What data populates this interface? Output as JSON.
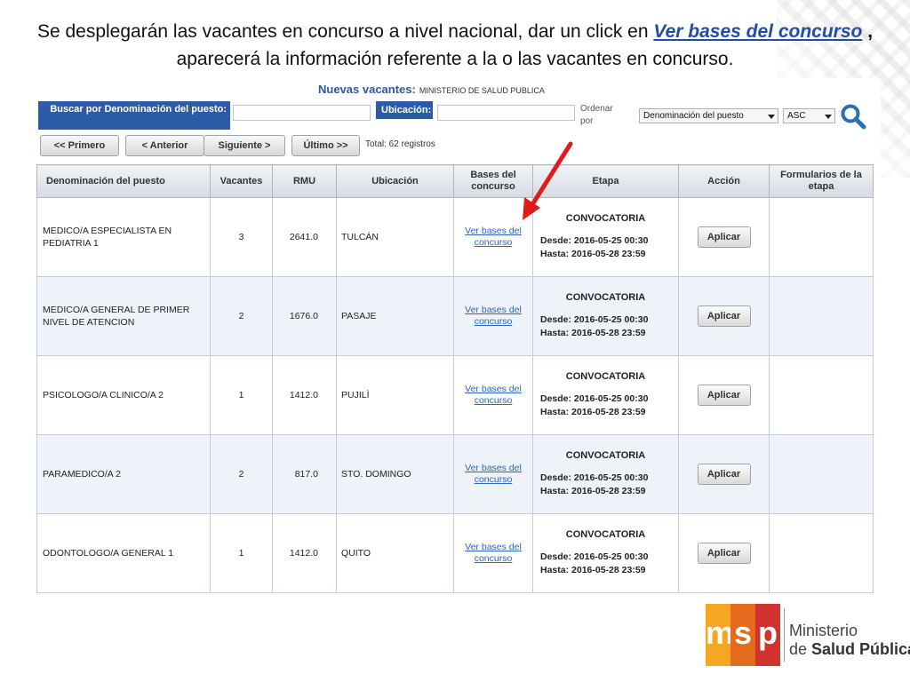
{
  "intro": {
    "before": "Se desplegarán las vacantes en concurso a nivel nacional, dar un click en ",
    "link": "Ver bases del concurso",
    "comma": " ,",
    "after": " aparecerá la información referente a la o las vacantes en concurso."
  },
  "header": {
    "title": "Nuevas vacantes:",
    "ministry": "MINISTERIO DE SALUD PUBLICA"
  },
  "filters": {
    "denom_label": "Buscar por Denominación del puesto:",
    "ubic_label": "Ubicación:",
    "denom_value": "",
    "ubic_value": "",
    "ordenar": "Ordenar por",
    "order_field": "Denominación del puesto",
    "order_dir": "ASC"
  },
  "pagination": {
    "first": "<< Primero",
    "prev": "< Anterior",
    "next": "Siguiente >",
    "last": "Último >>",
    "total": "Total: 62 registros"
  },
  "table": {
    "headers": [
      "Denominación del puesto",
      "Vacantes",
      "RMU",
      "Ubicación",
      "Bases del concurso",
      "Etapa",
      "Acción",
      "Formularios de la etapa"
    ],
    "rows": [
      {
        "puesto": "MEDICO/A ESPECIALISTA EN PEDIATRIA 1",
        "vacantes": "3",
        "rmu": "2641.0",
        "ubicacion": "TULCÁN",
        "bases": "Ver bases del concurso",
        "etapa": "CONVOCATORIA",
        "desde": "Desde:  2016-05-25   00:30",
        "hasta": "Hasta:    2016-05-28   23:59",
        "accion": "Aplicar",
        "formularios": ""
      },
      {
        "puesto": "MEDICO/A GENERAL DE PRIMER NIVEL DE ATENCION",
        "vacantes": "2",
        "rmu": "1676.0",
        "ubicacion": "PASAJE",
        "bases": "Ver bases del concurso",
        "etapa": "CONVOCATORIA",
        "desde": "Desde:  2016-05-25   00:30",
        "hasta": "Hasta:    2016-05-28   23:59",
        "accion": "Aplicar",
        "formularios": ""
      },
      {
        "puesto": "PSICOLOGO/A CLINICO/A 2",
        "vacantes": "1",
        "rmu": "1412.0",
        "ubicacion": "PUJILÌ",
        "bases": "Ver bases del concurso",
        "etapa": "CONVOCATORIA",
        "desde": "Desde:  2016-05-25   00:30",
        "hasta": "Hasta:    2016-05-28   23:59",
        "accion": "Aplicar",
        "formularios": ""
      },
      {
        "puesto": "PARAMEDICO/A 2",
        "vacantes": "2",
        "rmu": "817.0",
        "ubicacion": "STO. DOMINGO",
        "bases": "Ver bases del concurso",
        "etapa": "CONVOCATORIA",
        "desde": "Desde:  2016-05-25   00:30",
        "hasta": "Hasta:    2016-05-28   23:59",
        "accion": "Aplicar",
        "formularios": ""
      },
      {
        "puesto": "ODONTOLOGO/A GENERAL 1",
        "vacantes": "1",
        "rmu": "1412.0",
        "ubicacion": "QUITO",
        "bases": "Ver bases del concurso",
        "etapa": "CONVOCATORIA",
        "desde": "Desde:  2016-05-25   00:30",
        "hasta": "Hasta:    2016-05-28   23:59",
        "accion": "Aplicar",
        "formularios": ""
      }
    ]
  },
  "logo": {
    "letters": [
      "m",
      "s",
      "p"
    ],
    "line1": "Ministerio",
    "line2_prefix": "de ",
    "line2_bold": "Salud Pública"
  },
  "icons": {
    "search": "search-icon",
    "arrow": "red-arrow-icon",
    "dropdown": "chevron-down-icon"
  },
  "colors": {
    "accent_blue": "#2a5ca8",
    "link_blue": "#1f4ea8",
    "arrow_red": "#e11b1b",
    "row_alt": "#eef3f9",
    "logo_yellow": "#f6a623",
    "logo_orange": "#e46b1d",
    "logo_red": "#d2322d"
  }
}
